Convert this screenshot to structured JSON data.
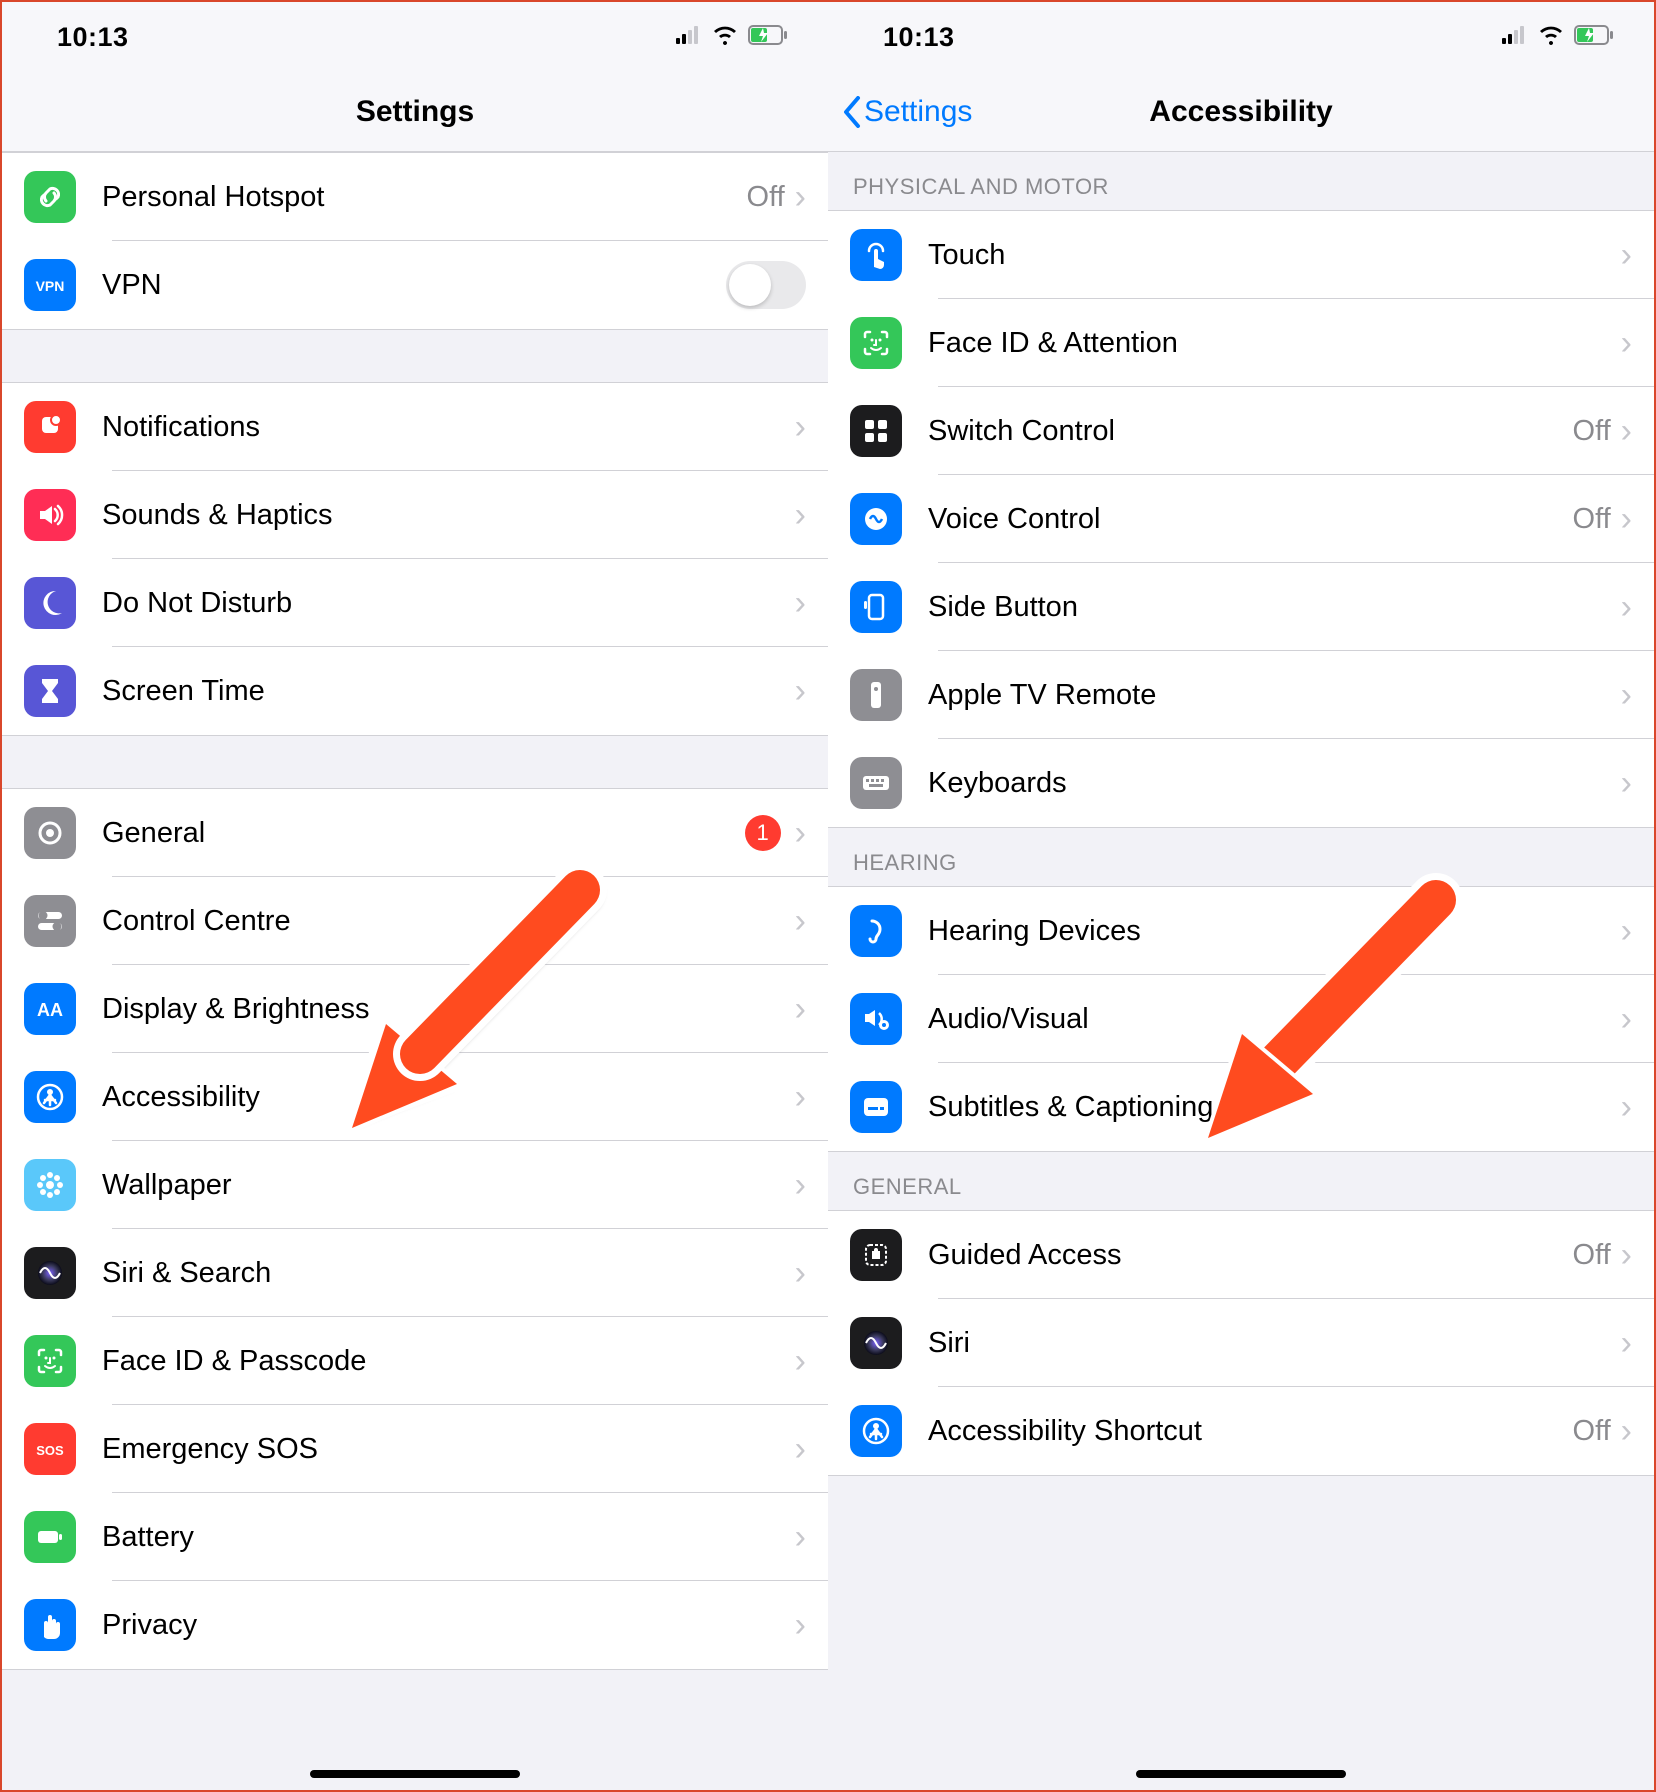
{
  "status": {
    "time": "10:13"
  },
  "left": {
    "title": "Settings",
    "badge_general": "1",
    "groups": [
      {
        "items": [
          {
            "icon": "link",
            "color": "bg-green",
            "label": "Personal Hotspot",
            "value": "Off",
            "chev": true
          },
          {
            "icon": "vpn",
            "color": "bg-blue",
            "label": "VPN",
            "toggle": true
          }
        ]
      },
      {
        "items": [
          {
            "icon": "bell",
            "color": "bg-red",
            "label": "Notifications",
            "chev": true
          },
          {
            "icon": "speaker",
            "color": "bg-pink",
            "label": "Sounds & Haptics",
            "chev": true
          },
          {
            "icon": "moon",
            "color": "bg-purple",
            "label": "Do Not Disturb",
            "chev": true
          },
          {
            "icon": "hourglass",
            "color": "bg-purple",
            "label": "Screen Time",
            "chev": true
          }
        ]
      },
      {
        "items": [
          {
            "icon": "gear",
            "color": "bg-gray",
            "label": "General",
            "badge": "1",
            "chev": true
          },
          {
            "icon": "switches",
            "color": "bg-gray",
            "label": "Control Centre",
            "chev": true
          },
          {
            "icon": "aa",
            "color": "bg-blue",
            "label": "Display & Brightness",
            "chev": true
          },
          {
            "icon": "person-circle",
            "color": "bg-blue",
            "label": "Accessibility",
            "chev": true
          },
          {
            "icon": "flower",
            "color": "bg-teal",
            "label": "Wallpaper",
            "chev": true
          },
          {
            "icon": "siri",
            "color": "bg-dark",
            "label": "Siri & Search",
            "chev": true
          },
          {
            "icon": "faceid",
            "color": "bg-green",
            "label": "Face ID & Passcode",
            "chev": true
          },
          {
            "icon": "sos",
            "color": "bg-red",
            "label": "Emergency SOS",
            "chev": true
          },
          {
            "icon": "battery",
            "color": "bg-green",
            "label": "Battery",
            "chev": true
          },
          {
            "icon": "hand",
            "color": "bg-blue",
            "label": "Privacy",
            "chev": true
          }
        ]
      }
    ]
  },
  "right": {
    "title": "Accessibility",
    "back": "Settings",
    "groups": [
      {
        "header": "Physical and Motor",
        "items": [
          {
            "icon": "touch",
            "color": "bg-blue",
            "label": "Touch",
            "chev": true
          },
          {
            "icon": "faceid",
            "color": "bg-green",
            "label": "Face ID & Attention",
            "chev": true
          },
          {
            "icon": "grid",
            "color": "bg-dark",
            "label": "Switch Control",
            "value": "Off",
            "chev": true
          },
          {
            "icon": "voice",
            "color": "bg-blue",
            "label": "Voice Control",
            "value": "Off",
            "chev": true
          },
          {
            "icon": "side",
            "color": "bg-blue",
            "label": "Side Button",
            "chev": true
          },
          {
            "icon": "remote",
            "color": "bg-gray",
            "label": "Apple TV Remote",
            "chev": true
          },
          {
            "icon": "keyboard",
            "color": "bg-gray",
            "label": "Keyboards",
            "chev": true
          }
        ]
      },
      {
        "header": "Hearing",
        "items": [
          {
            "icon": "ear",
            "color": "bg-blue",
            "label": "Hearing Devices",
            "chev": true
          },
          {
            "icon": "audiovisual",
            "color": "bg-blue",
            "label": "Audio/Visual",
            "chev": true
          },
          {
            "icon": "subtitles",
            "color": "bg-blue",
            "label": "Subtitles & Captioning",
            "chev": true
          }
        ]
      },
      {
        "header": "General",
        "items": [
          {
            "icon": "guided",
            "color": "bg-dark",
            "label": "Guided Access",
            "value": "Off",
            "chev": true
          },
          {
            "icon": "siri",
            "color": "bg-dark",
            "label": "Siri",
            "chev": true
          },
          {
            "icon": "person-circle",
            "color": "bg-blue",
            "label": "Accessibility Shortcut",
            "value": "Off",
            "chev": true
          }
        ]
      }
    ]
  }
}
